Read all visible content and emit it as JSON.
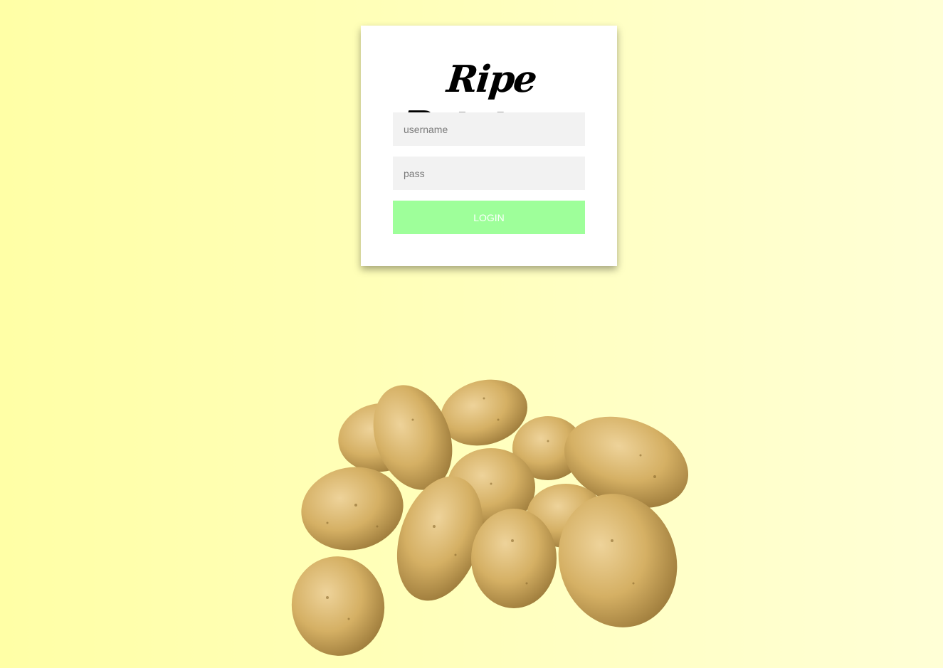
{
  "logo": {
    "text": "Ripe Potatoes"
  },
  "form": {
    "username_placeholder": "username",
    "username_value": "",
    "password_placeholder": "pass",
    "password_value": "",
    "login_label": "LOGIN"
  },
  "colors": {
    "background_left": "#ffffa6",
    "background_right": "#ffffd6",
    "card": "#ffffff",
    "input_fill": "#f2f2f2",
    "login_button": "#9eff9a",
    "login_text": "#ffffff",
    "potato_skin": "#d1ad63"
  },
  "image": {
    "subject": "pile-of-potatoes"
  }
}
